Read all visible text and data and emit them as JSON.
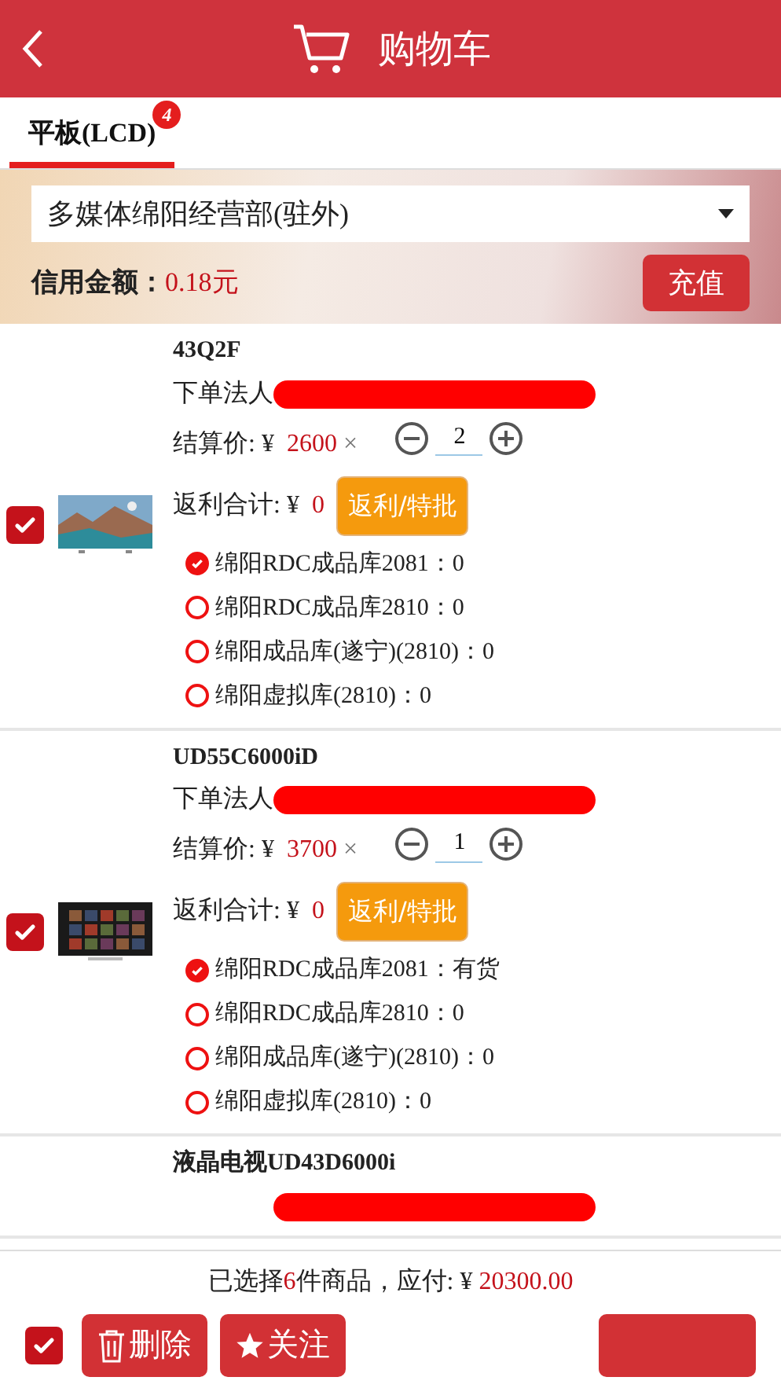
{
  "header": {
    "title": "购物车"
  },
  "tabs": [
    {
      "label": "平板(LCD)",
      "badge": "4",
      "selected": true
    }
  ],
  "store_select": {
    "value": "多媒体绵阳经营部(驻外)"
  },
  "credit": {
    "label": "信用金额：",
    "amount": "0.18元",
    "button": "充值"
  },
  "items": [
    {
      "checked": true,
      "name": "43Q2F",
      "legal_label": "下单法人",
      "price_label": "结算价: ¥",
      "price": "2600",
      "times": "×",
      "quantity": "2",
      "rebate_label": "返利合计: ¥",
      "rebate": "0",
      "rebate_button": "返利/特批",
      "warehouses": [
        {
          "label": "绵阳RDC成品库2081：0",
          "selected": true
        },
        {
          "label": "绵阳RDC成品库2810：0",
          "selected": false
        },
        {
          "label": "绵阳成品库(遂宁)(2810)：0",
          "selected": false
        },
        {
          "label": "绵阳虚拟库(2810)：0",
          "selected": false
        }
      ]
    },
    {
      "checked": true,
      "name": "UD55C6000iD",
      "legal_label": "下单法人",
      "price_label": "结算价: ¥",
      "price": "3700",
      "times": "×",
      "quantity": "1",
      "rebate_label": "返利合计: ¥",
      "rebate": "0",
      "rebate_button": "返利/特批",
      "warehouses": [
        {
          "label": "绵阳RDC成品库2081：有货",
          "selected": true
        },
        {
          "label": "绵阳RDC成品库2810：0",
          "selected": false
        },
        {
          "label": "绵阳成品库(遂宁)(2810)：0",
          "selected": false
        },
        {
          "label": "绵阳虚拟库(2810)：0",
          "selected": false
        }
      ]
    },
    {
      "name": "液晶电视UD43D6000i"
    }
  ],
  "footer": {
    "summary_prefix": "已选择",
    "count": "6",
    "summary_mid": "件商品，应付: ¥",
    "total": "20300.00",
    "all_checked": true,
    "buttons": [
      {
        "kind": "trash",
        "label": "删除"
      },
      {
        "kind": "star",
        "label": "关注"
      },
      {
        "kind": "blank"
      }
    ]
  }
}
